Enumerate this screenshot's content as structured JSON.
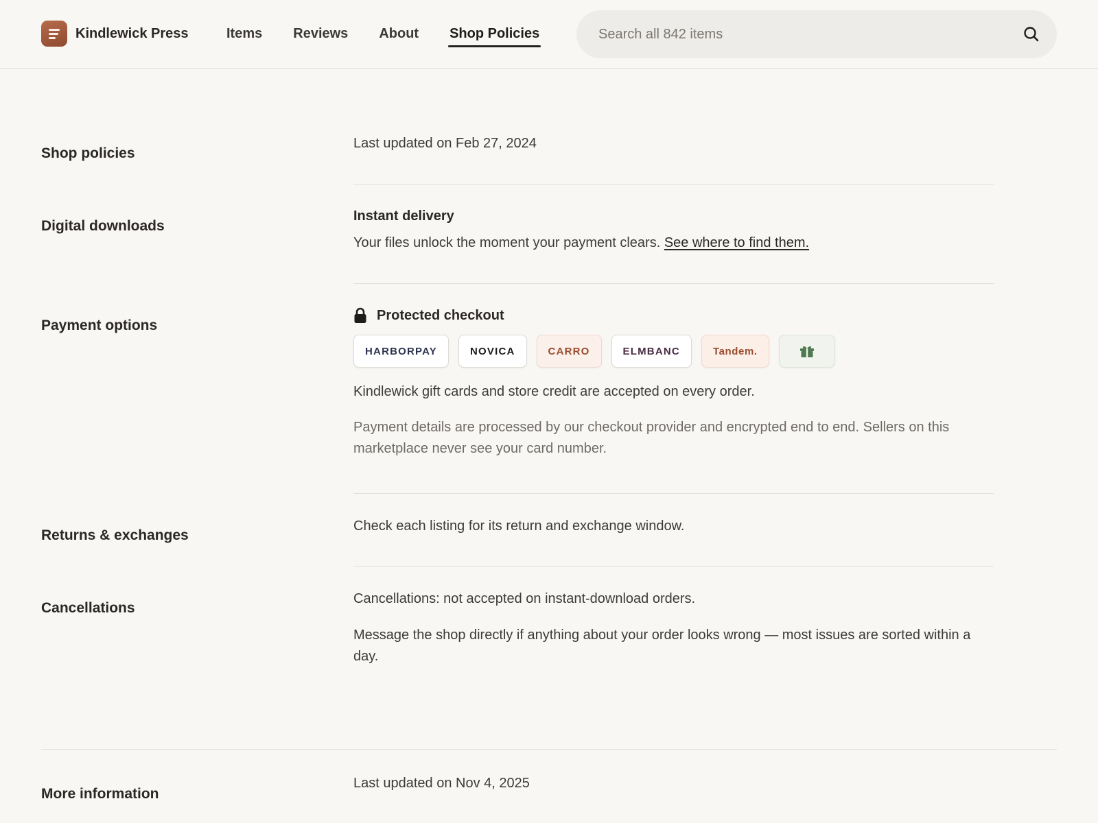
{
  "header": {
    "brand_name": "Kindlewick Press",
    "nav": [
      {
        "label": "Items",
        "active": false
      },
      {
        "label": "Reviews",
        "active": false
      },
      {
        "label": "About",
        "active": false
      },
      {
        "label": "Shop Policies",
        "active": true
      }
    ],
    "search_placeholder": "Search all 842 items",
    "search_icon": "search-icon"
  },
  "sections": {
    "shop_policies": {
      "label": "Shop policies",
      "updated": "Last updated on Feb 27, 2024"
    },
    "digital_downloads": {
      "label": "Digital downloads",
      "heading": "Instant delivery",
      "body": "Your files unlock the moment your payment clears.",
      "link": "See where to find them."
    },
    "payment_options": {
      "label": "Payment options",
      "heading": "Protected checkout",
      "lock_icon": "lock-icon",
      "methods": [
        "HARBORPAY",
        "NOVICA",
        "CARRO",
        "ELMBANC",
        "Tandem."
      ],
      "gift_icon": "gift-card-icon",
      "gift_note": "Kindlewick gift cards and store credit are accepted on every order.",
      "security_note": "Payment details are processed by our checkout provider and encrypted end to end. Sellers on this marketplace never see your card number."
    },
    "returns": {
      "label": "Returns & exchanges",
      "body": "Check each listing for its return and exchange window."
    },
    "cancellations": {
      "label": "Cancellations",
      "body": "Cancellations: not accepted on instant-download orders.",
      "note": "Message the shop directly if anything about your order looks wrong — most issues are sorted within a day."
    },
    "more_info": {
      "label": "More information",
      "updated": "Last updated on Nov 4, 2025"
    }
  },
  "colors": {
    "background": "#f8f7f4",
    "brand": "#a65a3c",
    "divider": "#e2dfda"
  }
}
